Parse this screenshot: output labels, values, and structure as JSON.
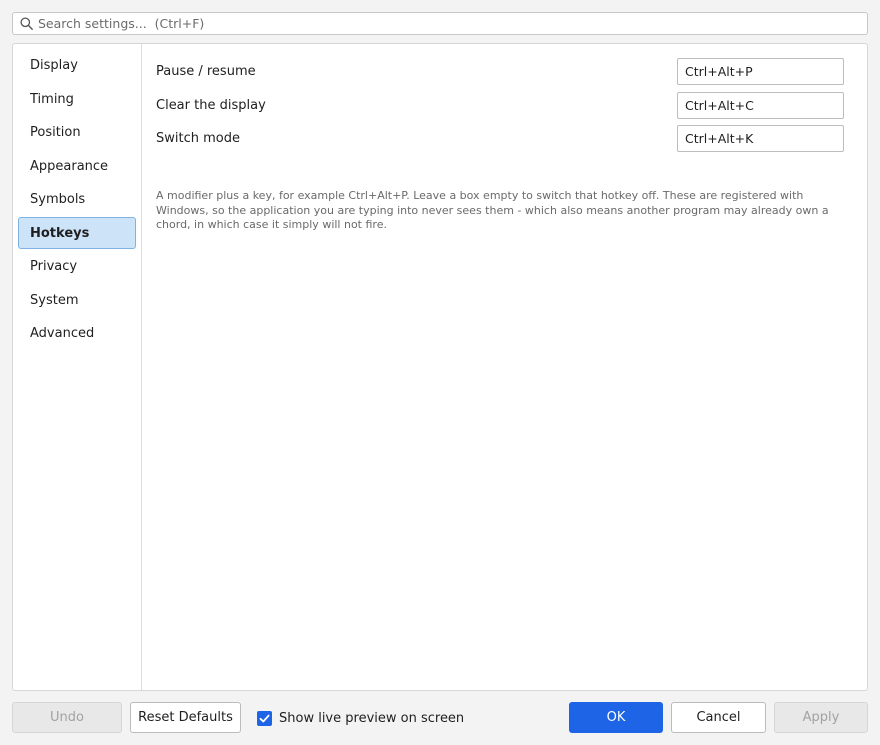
{
  "search": {
    "placeholder": "Search settings...  (Ctrl+F)"
  },
  "sidebar": {
    "items": [
      {
        "label": "Display"
      },
      {
        "label": "Timing"
      },
      {
        "label": "Position"
      },
      {
        "label": "Appearance"
      },
      {
        "label": "Symbols"
      },
      {
        "label": "Hotkeys",
        "active": true
      },
      {
        "label": "Privacy"
      },
      {
        "label": "System"
      },
      {
        "label": "Advanced"
      }
    ]
  },
  "hotkeys": [
    {
      "label": "Pause / resume",
      "value": "Ctrl+Alt+P"
    },
    {
      "label": "Clear the display",
      "value": "Ctrl+Alt+C"
    },
    {
      "label": "Switch mode",
      "value": "Ctrl+Alt+K"
    }
  ],
  "help_text": "A modifier plus a key, for example Ctrl+Alt+P. Leave a box empty to switch that hotkey off. These are registered with Windows, so the application you are typing into never sees them - which also means another program may already own a chord, in which case it simply will not fire.",
  "footer": {
    "undo_label": "Undo",
    "reset_label": "Reset Defaults",
    "preview_label": "Show live preview on screen",
    "preview_checked": true,
    "ok_label": "OK",
    "cancel_label": "Cancel",
    "apply_label": "Apply"
  },
  "colors": {
    "accent": "#1d64e6",
    "selected_bg": "#cde4f8",
    "selected_border": "#7fb1e2"
  }
}
